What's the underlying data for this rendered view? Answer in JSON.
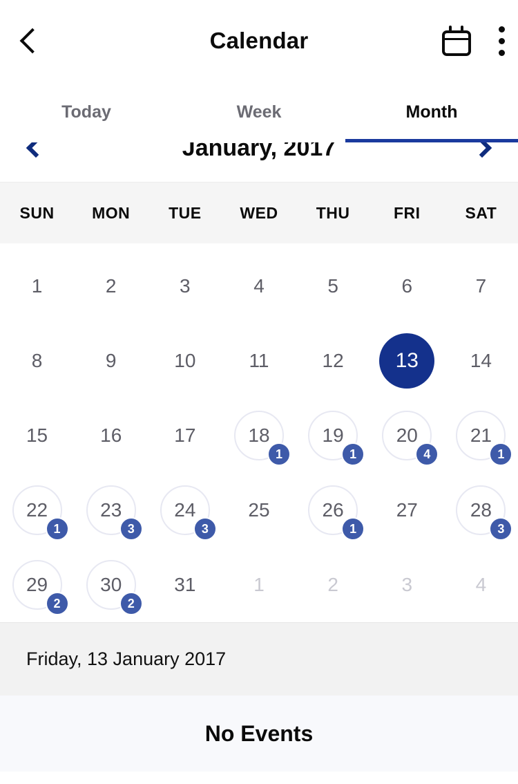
{
  "appbar": {
    "back_icon": "chevron-left-icon",
    "title": "Calendar",
    "calendar_icon": "calendar-icon",
    "overflow_icon": "kebab-menu-icon"
  },
  "tabs": [
    {
      "label": "Today",
      "active": false
    },
    {
      "label": "Week",
      "active": false
    },
    {
      "label": "Month",
      "active": true
    }
  ],
  "month_nav": {
    "prev_icon": "chevron-left-icon",
    "label": "January, 2017",
    "next_icon": "chevron-right-icon"
  },
  "weekdays": [
    "SUN",
    "MON",
    "TUE",
    "WED",
    "THU",
    "FRI",
    "SAT"
  ],
  "weeks": [
    [
      {
        "day": "1",
        "events": 0,
        "muted": false,
        "selected": false
      },
      {
        "day": "2",
        "events": 0,
        "muted": false,
        "selected": false
      },
      {
        "day": "3",
        "events": 0,
        "muted": false,
        "selected": false
      },
      {
        "day": "4",
        "events": 0,
        "muted": false,
        "selected": false
      },
      {
        "day": "5",
        "events": 0,
        "muted": false,
        "selected": false
      },
      {
        "day": "6",
        "events": 0,
        "muted": false,
        "selected": false
      },
      {
        "day": "7",
        "events": 0,
        "muted": false,
        "selected": false
      }
    ],
    [
      {
        "day": "8",
        "events": 0,
        "muted": false,
        "selected": false
      },
      {
        "day": "9",
        "events": 0,
        "muted": false,
        "selected": false
      },
      {
        "day": "10",
        "events": 0,
        "muted": false,
        "selected": false
      },
      {
        "day": "11",
        "events": 0,
        "muted": false,
        "selected": false
      },
      {
        "day": "12",
        "events": 0,
        "muted": false,
        "selected": false
      },
      {
        "day": "13",
        "events": 0,
        "muted": false,
        "selected": true
      },
      {
        "day": "14",
        "events": 0,
        "muted": false,
        "selected": false
      }
    ],
    [
      {
        "day": "15",
        "events": 0,
        "muted": false,
        "selected": false
      },
      {
        "day": "16",
        "events": 0,
        "muted": false,
        "selected": false
      },
      {
        "day": "17",
        "events": 0,
        "muted": false,
        "selected": false
      },
      {
        "day": "18",
        "events": 1,
        "muted": false,
        "selected": false
      },
      {
        "day": "19",
        "events": 1,
        "muted": false,
        "selected": false
      },
      {
        "day": "20",
        "events": 4,
        "muted": false,
        "selected": false
      },
      {
        "day": "21",
        "events": 1,
        "muted": false,
        "selected": false
      }
    ],
    [
      {
        "day": "22",
        "events": 1,
        "muted": false,
        "selected": false
      },
      {
        "day": "23",
        "events": 3,
        "muted": false,
        "selected": false
      },
      {
        "day": "24",
        "events": 3,
        "muted": false,
        "selected": false
      },
      {
        "day": "25",
        "events": 0,
        "muted": false,
        "selected": false
      },
      {
        "day": "26",
        "events": 1,
        "muted": false,
        "selected": false
      },
      {
        "day": "27",
        "events": 0,
        "muted": false,
        "selected": false
      },
      {
        "day": "28",
        "events": 3,
        "muted": false,
        "selected": false
      }
    ],
    [
      {
        "day": "29",
        "events": 2,
        "muted": false,
        "selected": false
      },
      {
        "day": "30",
        "events": 2,
        "muted": false,
        "selected": false
      },
      {
        "day": "31",
        "events": 0,
        "muted": false,
        "selected": false
      },
      {
        "day": "1",
        "events": 0,
        "muted": true,
        "selected": false
      },
      {
        "day": "2",
        "events": 0,
        "muted": true,
        "selected": false
      },
      {
        "day": "3",
        "events": 0,
        "muted": true,
        "selected": false
      },
      {
        "day": "4",
        "events": 0,
        "muted": true,
        "selected": false
      }
    ]
  ],
  "selected_date_label": "Friday, 13 January 2017",
  "events_empty_label": "No Events",
  "colors": {
    "selected_day": "#14318c",
    "badge": "#3e5aa9",
    "tab_underline": "#1a3a9e",
    "nav_arrow": "#0f2c7d",
    "weekday_header_bg": "#f5f5f5",
    "date_bar_bg": "#f2f2f2",
    "events_pane_bg": "#f8f9fc"
  }
}
